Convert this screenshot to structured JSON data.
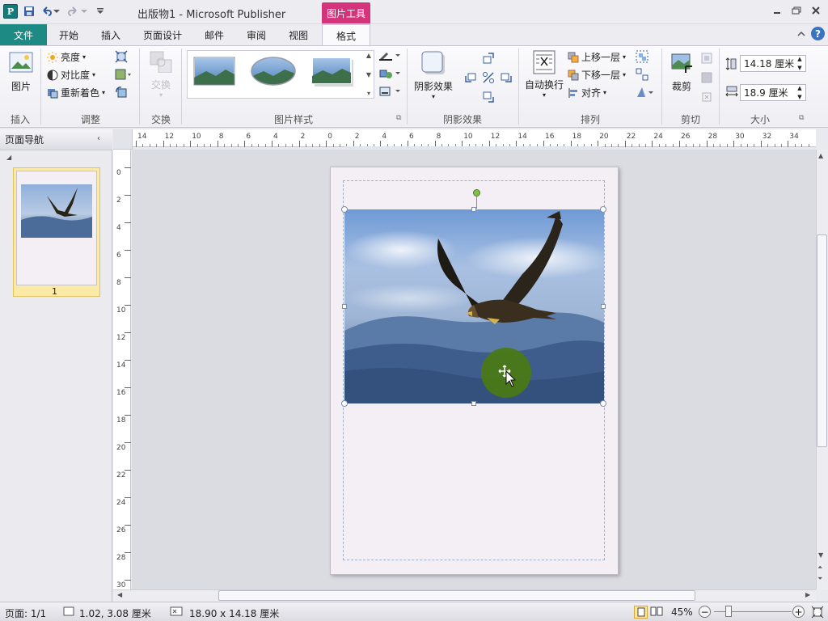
{
  "app": {
    "window_title": "出版物1  -  Microsoft Publisher",
    "contextual_tab_group": "图片工具"
  },
  "tabs": [
    {
      "label": "文件",
      "active": false
    },
    {
      "label": "开始",
      "active": false
    },
    {
      "label": "插入",
      "active": false
    },
    {
      "label": "页面设计",
      "active": false
    },
    {
      "label": "邮件",
      "active": false
    },
    {
      "label": "审阅",
      "active": false
    },
    {
      "label": "视图",
      "active": false
    },
    {
      "label": "格式",
      "active": true
    }
  ],
  "ribbon": {
    "insert": {
      "picture_label": "图片",
      "group_label": "插入"
    },
    "adjust": {
      "brightness": "亮度",
      "contrast": "对比度",
      "recolor": "重新着色",
      "group_label": "调整"
    },
    "swap": {
      "swap_label": "交换",
      "group_label": "交换"
    },
    "picture_styles": {
      "group_label": "图片样式"
    },
    "shadow": {
      "shadow_label": "阴影效果",
      "group_label": "阴影效果"
    },
    "arrange": {
      "wrap_text": "自动换行",
      "bring_forward": "上移一层",
      "send_backward": "下移一层",
      "align": "对齐",
      "group_label": "排列"
    },
    "crop": {
      "crop_label": "裁剪",
      "group_label": "剪切"
    },
    "size": {
      "height_value": "14.18 厘米",
      "width_value": "18.9 厘米",
      "group_label": "大小"
    }
  },
  "nav": {
    "title": "页面导航",
    "page_number": "1"
  },
  "ruler": {
    "h_ticks": [
      "14",
      "12",
      "10",
      "8",
      "6",
      "4",
      "2",
      "0",
      "2",
      "4",
      "6",
      "8",
      "10",
      "12",
      "14",
      "16",
      "18",
      "20",
      "22",
      "24",
      "26",
      "28",
      "30",
      "32",
      "34"
    ],
    "v_ticks": [
      "0",
      "2",
      "4",
      "6",
      "8",
      "10",
      "12",
      "14",
      "16",
      "18",
      "20",
      "22",
      "24",
      "26",
      "28",
      "30"
    ]
  },
  "status": {
    "page": "页面: 1/1",
    "position": "1.02, 3.08 厘米",
    "size": "18.90 x  14.18 厘米",
    "zoom": "45%"
  },
  "colors": {
    "accent": "#1d8a83",
    "context": "#d4357a",
    "cursor_highlight": "#4a7a12"
  }
}
